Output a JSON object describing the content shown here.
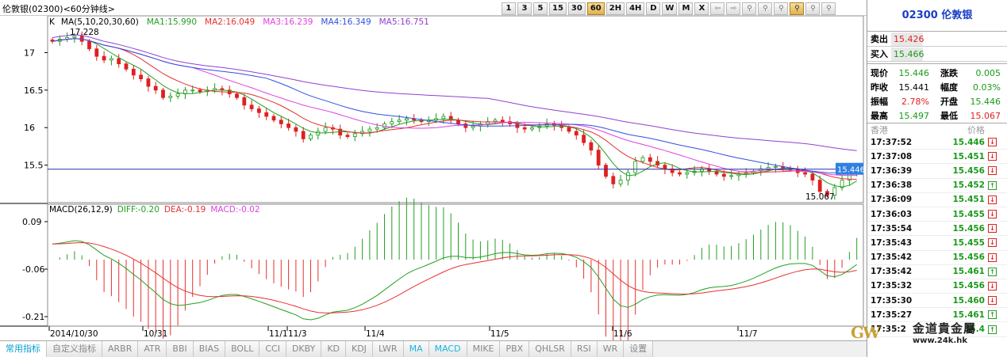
{
  "window_title": "伦敦银(02300)<60分钟线>",
  "toolbar": {
    "periods": [
      "1",
      "3",
      "5",
      "15",
      "30",
      "60",
      "2H",
      "4H",
      "D",
      "W",
      "M",
      "X"
    ],
    "active_period": "60",
    "tools": [
      {
        "name": "arrow-left-icon",
        "glyph": "⇦"
      },
      {
        "name": "arrow-right-icon",
        "glyph": "⇨"
      },
      {
        "name": "zoom-icon",
        "glyph": "⚲"
      },
      {
        "name": "zoom-in-icon",
        "glyph": "⚲"
      },
      {
        "name": "zoom-out-icon",
        "glyph": "⚲"
      },
      {
        "name": "zoom-active-icon",
        "glyph": "⚲"
      },
      {
        "name": "zoom-reset-icon",
        "glyph": "⚲"
      },
      {
        "name": "zoom-fit-icon",
        "glyph": "⚲"
      }
    ]
  },
  "main_chart": {
    "k_label": "K",
    "ma_params": "MA(5,10,20,30,60)",
    "ma": [
      {
        "label": "MA1:15.990",
        "color": "#22a022"
      },
      {
        "label": "MA2:16.049",
        "color": "#e83030"
      },
      {
        "label": "MA3:16.239",
        "color": "#e040e0"
      },
      {
        "label": "MA4:16.349",
        "color": "#3050e0"
      },
      {
        "label": "MA5:16.751",
        "color": "#9040d0"
      }
    ],
    "high_label": "17.228",
    "low_label": "15.067",
    "current_price": "15.446",
    "y_ticks": [
      "17",
      "16.5",
      "16",
      "15.5"
    ]
  },
  "macd_panel": {
    "params": "MACD(26,12,9)",
    "diff": "DIFF:-0.20",
    "dea": "DEA:-0.19",
    "macd": "MACD:-0.02",
    "y_ticks": [
      "0.09",
      "-0.06",
      "-0.21"
    ]
  },
  "x_labels": [
    "2014/10/30",
    "10/31",
    "11/1",
    "11/3",
    "11/4",
    "11/5",
    "11/6",
    "11/7"
  ],
  "chart_data": {
    "type": "candlestick",
    "title": "伦敦银(02300)<60分钟线>",
    "ylim": [
      15.0,
      17.3
    ],
    "high": 17.228,
    "low": 15.067,
    "last": 15.446,
    "close_series": [
      17.15,
      17.18,
      17.2,
      17.22,
      17.15,
      17.05,
      16.95,
      16.9,
      16.92,
      16.85,
      16.78,
      16.7,
      16.65,
      16.55,
      16.5,
      16.4,
      16.42,
      16.45,
      16.5,
      16.5,
      16.48,
      16.5,
      16.52,
      16.5,
      16.45,
      16.4,
      16.3,
      16.25,
      16.2,
      16.15,
      16.1,
      16.05,
      16.0,
      15.95,
      15.85,
      15.9,
      15.95,
      16.0,
      15.98,
      15.9,
      15.88,
      15.92,
      15.95,
      15.98,
      16.0,
      16.05,
      16.08,
      16.1,
      16.12,
      16.1,
      16.08,
      16.1,
      16.12,
      16.15,
      16.1,
      16.05,
      16.0,
      16.02,
      16.05,
      16.08,
      16.1,
      16.08,
      16.05,
      16.0,
      15.98,
      16.0,
      16.02,
      16.05,
      16.03,
      16.0,
      15.95,
      15.9,
      15.8,
      15.7,
      15.5,
      15.35,
      15.25,
      15.3,
      15.4,
      15.55,
      15.6,
      15.55,
      15.5,
      15.45,
      15.4,
      15.38,
      15.4,
      15.42,
      15.45,
      15.42,
      15.38,
      15.35,
      15.36,
      15.38,
      15.4,
      15.42,
      15.45,
      15.47,
      15.48,
      15.46,
      15.44,
      15.4,
      15.38,
      15.3,
      15.15,
      15.1,
      15.2,
      15.3,
      15.4,
      15.446
    ],
    "macd_ylim": [
      -0.24,
      0.12
    ],
    "diff_range": [
      -0.22,
      0.03
    ],
    "dea_range": [
      -0.21,
      0.02
    ]
  },
  "tabs": [
    "常用指标",
    "自定义指标",
    "ARBR",
    "ATR",
    "BBI",
    "BIAS",
    "BOLL",
    "CCI",
    "DKBY",
    "KD",
    "KDJ",
    "LWR",
    "MA",
    "MACD",
    "MIKE",
    "PBX",
    "QHLSR",
    "RSI",
    "WR",
    "设置"
  ],
  "highlight_tabs": [
    "MA",
    "MACD"
  ],
  "side": {
    "stock_title": "02300 伦敦银",
    "sell_label": "卖出",
    "sell_value": "15.426",
    "buy_label": "买入",
    "buy_value": "15.466",
    "quote": [
      {
        "l1": "现价",
        "v1": "15.446",
        "c1": "#1a9a1a",
        "l2": "涨跌",
        "v2": "0.005",
        "c2": "#1a9a1a"
      },
      {
        "l1": "昨收",
        "v1": "15.441",
        "c1": "#000000",
        "l2": "幅度",
        "v2": "0.03%",
        "c2": "#1a9a1a"
      },
      {
        "l1": "振幅",
        "v1": "2.78%",
        "c1": "#e02020",
        "l2": "开盘",
        "v2": "15.446",
        "c2": "#1a9a1a"
      },
      {
        "l1": "最高",
        "v1": "15.497",
        "c1": "#1a9a1a",
        "l2": "最低",
        "v2": "15.067",
        "c2": "#e02020"
      }
    ],
    "trades_head_left": "香港",
    "trades_head_right": "价格",
    "trades": [
      {
        "time": "17:37:52",
        "price": "15.446",
        "dir": "down"
      },
      {
        "time": "17:37:08",
        "price": "15.451",
        "dir": "down"
      },
      {
        "time": "17:36:39",
        "price": "15.456",
        "dir": "down"
      },
      {
        "time": "17:36:38",
        "price": "15.452",
        "dir": "up"
      },
      {
        "time": "17:36:09",
        "price": "15.451",
        "dir": "down"
      },
      {
        "time": "17:36:03",
        "price": "15.455",
        "dir": "down"
      },
      {
        "time": "17:35:54",
        "price": "15.456",
        "dir": "down"
      },
      {
        "time": "17:35:43",
        "price": "15.455",
        "dir": "down"
      },
      {
        "time": "17:35:42",
        "price": "15.456",
        "dir": "down"
      },
      {
        "time": "17:35:42",
        "price": "15.461",
        "dir": "up"
      },
      {
        "time": "17:35:32",
        "price": "15.456",
        "dir": "down"
      },
      {
        "time": "17:35:30",
        "price": "15.460",
        "dir": "down"
      },
      {
        "time": "17:35:27",
        "price": "15.461",
        "dir": "up"
      },
      {
        "time": "17:35:2",
        "price": "15.4",
        "dir": "up"
      }
    ]
  },
  "watermark": {
    "logo": "GW",
    "name": "金道貴金屬",
    "url": "www.24k.hk"
  }
}
